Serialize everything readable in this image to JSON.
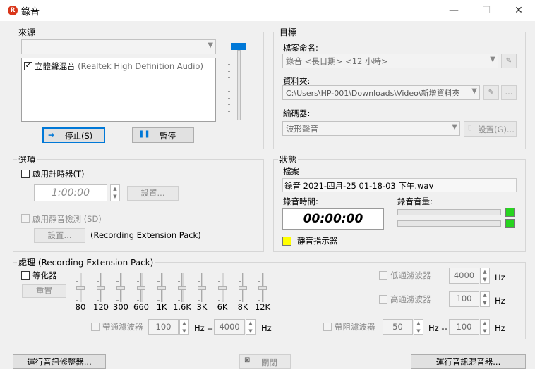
{
  "window": {
    "title": "錄音",
    "app_icon_letter": "R",
    "minimize": "—",
    "maximize": "☐",
    "close": "✕"
  },
  "source": {
    "title": "來源",
    "device_combo": "",
    "inputs": [
      {
        "name": "立體聲混音",
        "detail": "(Realtek High Definition Audio)",
        "checked": true
      }
    ],
    "volume_level": 0.0,
    "stop_label": "停止(S)",
    "pause_label": "暫停"
  },
  "target": {
    "title": "目標",
    "filename_label": "檔案命名:",
    "filename_value": "錄音 <長日期> <12 小時>",
    "folder_label": "資料夾:",
    "folder_value": "C:\\Users\\HP-001\\Downloads\\Video\\新增資料夾",
    "folder_browse": "...",
    "encoder_label": "編碼器:",
    "encoder_value": "波形聲音",
    "encoder_settings": "設置(G)..."
  },
  "options": {
    "title": "選項",
    "timer_label": "啟用計時器(T)",
    "timer_value": "1:00:00",
    "timer_settings": "設置...",
    "silence_label": "啟用靜音檢測 (SD)",
    "silence_settings": "設置...",
    "silence_note": "(Recording Extension Pack)"
  },
  "status": {
    "title": "狀態",
    "file_label": "檔案",
    "file_value": "錄音 2021-四月-25 01-18-03 下午.wav",
    "time_label": "錄音時間:",
    "time_value": "00:00:00",
    "volume_label": "錄音音量:",
    "silence_indicator": "靜音指示器"
  },
  "processing": {
    "title": "處理 (Recording Extension Pack)",
    "eq_label": "等化器",
    "reset_label": "重置",
    "bands": [
      "80",
      "120",
      "300",
      "660",
      "1K",
      "1.6K",
      "3K",
      "6K",
      "8K",
      "12K"
    ],
    "lowpass_label": "低通濾波器",
    "lowpass_value": "4000",
    "highpass_label": "高通濾波器",
    "highpass_value": "100",
    "bandpass_label": "帶通濾波器",
    "bandpass_low": "100",
    "bandpass_high": "4000",
    "bandstop_label": "帶阻濾波器",
    "bandstop_low": "50",
    "bandstop_high": "100",
    "hz": "Hz",
    "hz_range": "Hz --"
  },
  "footer": {
    "repair_label": "運行音訊修整器...",
    "close_label": "關閉",
    "mixer_label": "運行音訊混音器..."
  },
  "colors": {
    "accent": "#0078d7",
    "meter_green": "#27d41f",
    "silence_yellow": "#ffff00",
    "app_icon": "#d9361a"
  }
}
